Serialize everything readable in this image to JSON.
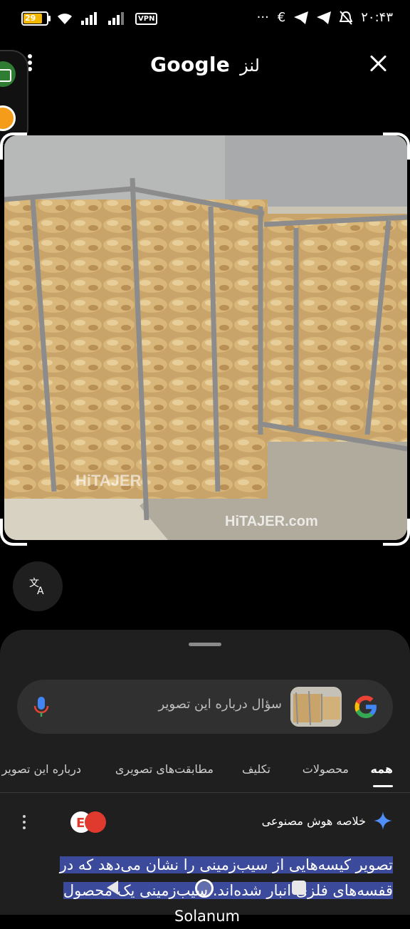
{
  "status_bar": {
    "battery": "29",
    "vpn": "VPN",
    "icons_right": [
      "more-dots-icon",
      "euro-icon",
      "telegram-icon",
      "telegram-icon",
      "alarm-off-icon"
    ],
    "time": "۲۰:۴۳"
  },
  "header": {
    "brand": "Google",
    "app_name": "لنز"
  },
  "photo": {
    "watermark_1": "HiTAJER",
    "watermark_2": "HiTAJER.com"
  },
  "search": {
    "placeholder": "سؤال درباره این تصویر"
  },
  "tabs": [
    {
      "label": "همه",
      "active": true
    },
    {
      "label": "محصولات",
      "active": false
    },
    {
      "label": "تکلیف",
      "active": false
    },
    {
      "label": "مطابقت‌های تصویری",
      "active": false
    },
    {
      "label": "درباره این تصویر",
      "active": false
    }
  ],
  "ai_overview": {
    "title": "خلاصه هوش مصنوعی",
    "line1": "تصویر کیسه‌هایی از سیب‌زمینی را نشان می‌دهد که در",
    "line2": "قفسه‌های فلزی انبار شده‌اند. سیب‌زمینی یک محصول",
    "line3": "Solanum"
  },
  "colors": {
    "accent_highlight": "#3b4a9a",
    "sheet_bg": "#1f1f1f",
    "search_bg": "#303030"
  }
}
